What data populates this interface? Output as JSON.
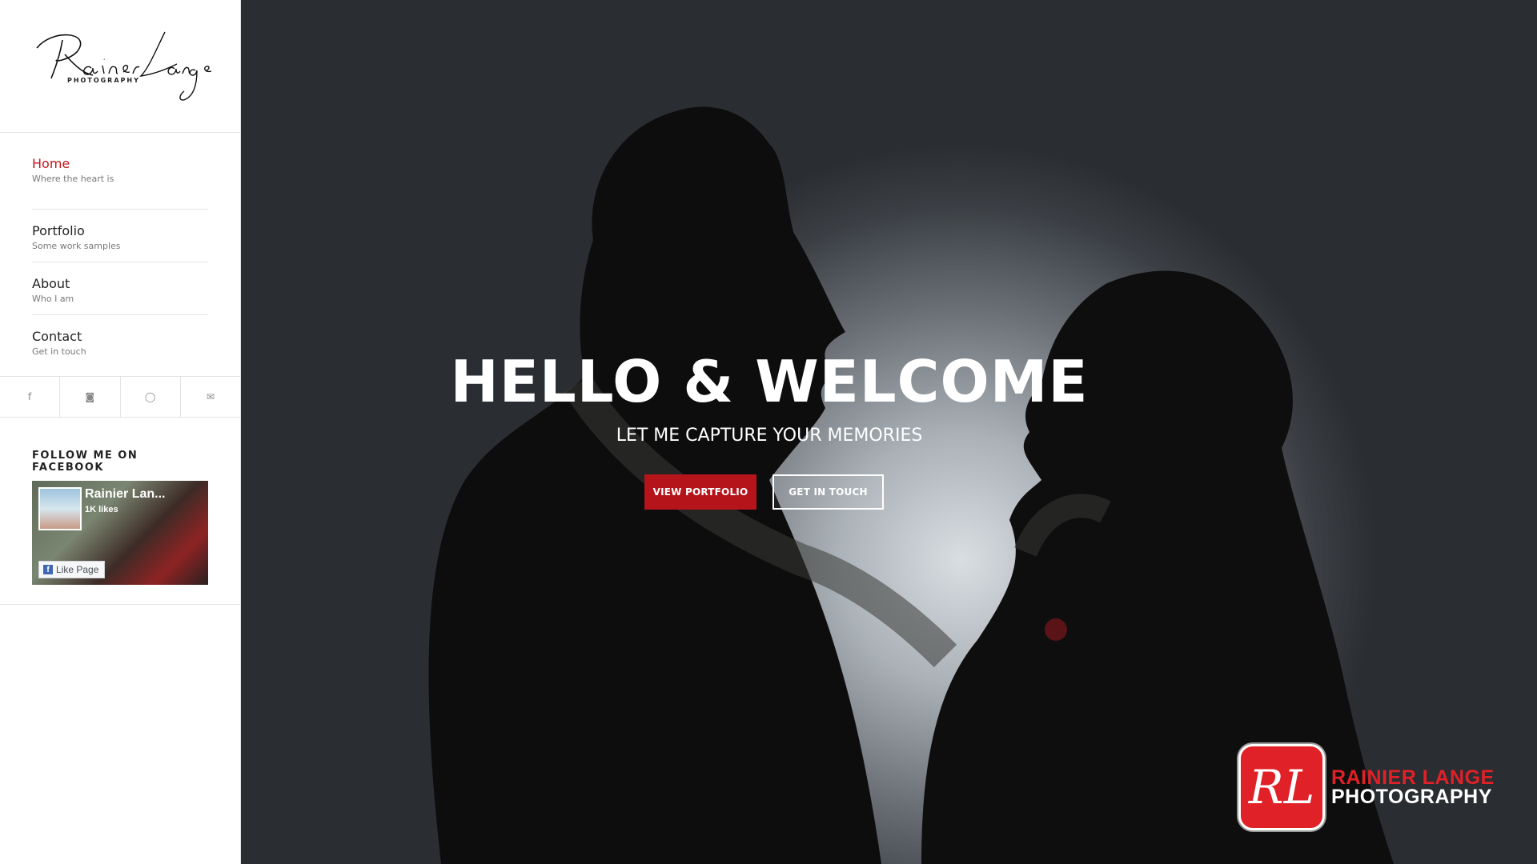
{
  "brand": {
    "logo_script": "Rainier Lange",
    "logo_sub": "PHOTOGRAPHY"
  },
  "nav": {
    "items": [
      {
        "title": "Home",
        "subtitle": "Where the heart is",
        "active": true
      },
      {
        "title": "Portfolio",
        "subtitle": "Some work samples",
        "active": false
      },
      {
        "title": "About",
        "subtitle": "Who I am",
        "active": false
      },
      {
        "title": "Contact",
        "subtitle": "Get in touch",
        "active": false
      }
    ]
  },
  "social": {
    "facebook": "f",
    "instagram": "◙",
    "whatsapp": "◯",
    "email": "✉"
  },
  "facebook_widget": {
    "heading": "FOLLOW ME ON FACEBOOK",
    "page_name": "Rainier Lan...",
    "likes": "1K likes",
    "like_button": "Like Page"
  },
  "hero": {
    "title": "HELLO & WELCOME",
    "subtitle": "LET ME CAPTURE YOUR MEMORIES",
    "primary_button": "VIEW PORTFOLIO",
    "secondary_button": "GET IN TOUCH"
  },
  "watermark": {
    "badge": "RL",
    "line1": "RAINIER LANGE",
    "line2": "PHOTOGRAPHY"
  },
  "colors": {
    "accent": "#c3161c",
    "button_red": "#b5141a",
    "watermark_red": "#e02127"
  }
}
